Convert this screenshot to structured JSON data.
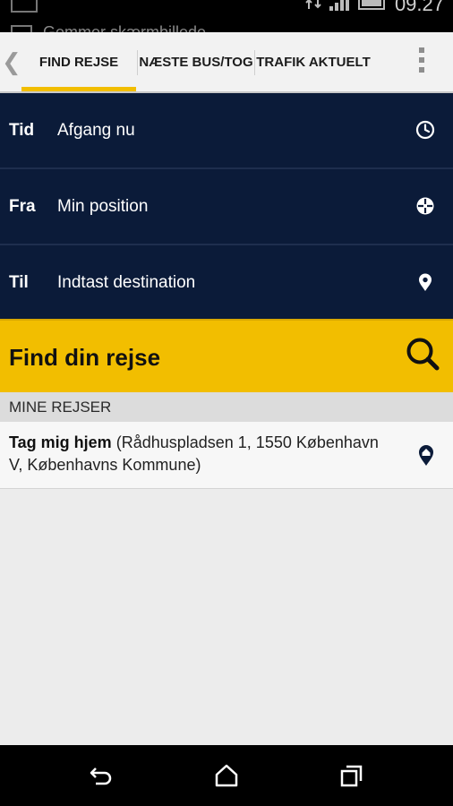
{
  "status_bar": {
    "ticker": "Gemmer skærmbillede",
    "clock": "09.27",
    "icons": [
      "screenshot-notification-icon",
      "data-transfer-icon",
      "signal-icon",
      "battery-icon"
    ]
  },
  "tabs": {
    "prev_icon": "chevron-left-icon",
    "items": [
      {
        "label": "FIND REJSE",
        "active": true
      },
      {
        "label": "NÆSTE BUS/TOG",
        "active": false
      },
      {
        "label": "TRAFIK AKTUELT",
        "active": false
      }
    ],
    "menu_icon": "overflow-menu-icon",
    "accent": "#f2be00"
  },
  "form": {
    "rows": [
      {
        "label": "Tid",
        "value": "Afgang nu",
        "icon": "clock-icon"
      },
      {
        "label": "Fra",
        "value": "Min position",
        "icon": "crosshair-icon"
      },
      {
        "label": "Til",
        "value": "Indtast destination",
        "icon": "location-pin-icon"
      }
    ],
    "background": "#0b1b39"
  },
  "search": {
    "label": "Find din rejse",
    "icon": "search-icon",
    "color": "#f2be00"
  },
  "my_trips": {
    "header": "MINE REJSER",
    "items": [
      {
        "name": "Tag mig hjem",
        "detail": "(Rådhuspladsen 1, 1550 København V, Københavns Kommune)",
        "icon": "home-pin-icon"
      }
    ]
  },
  "nav_bar": {
    "icons": [
      "back-icon",
      "home-icon",
      "recent-apps-icon"
    ]
  }
}
